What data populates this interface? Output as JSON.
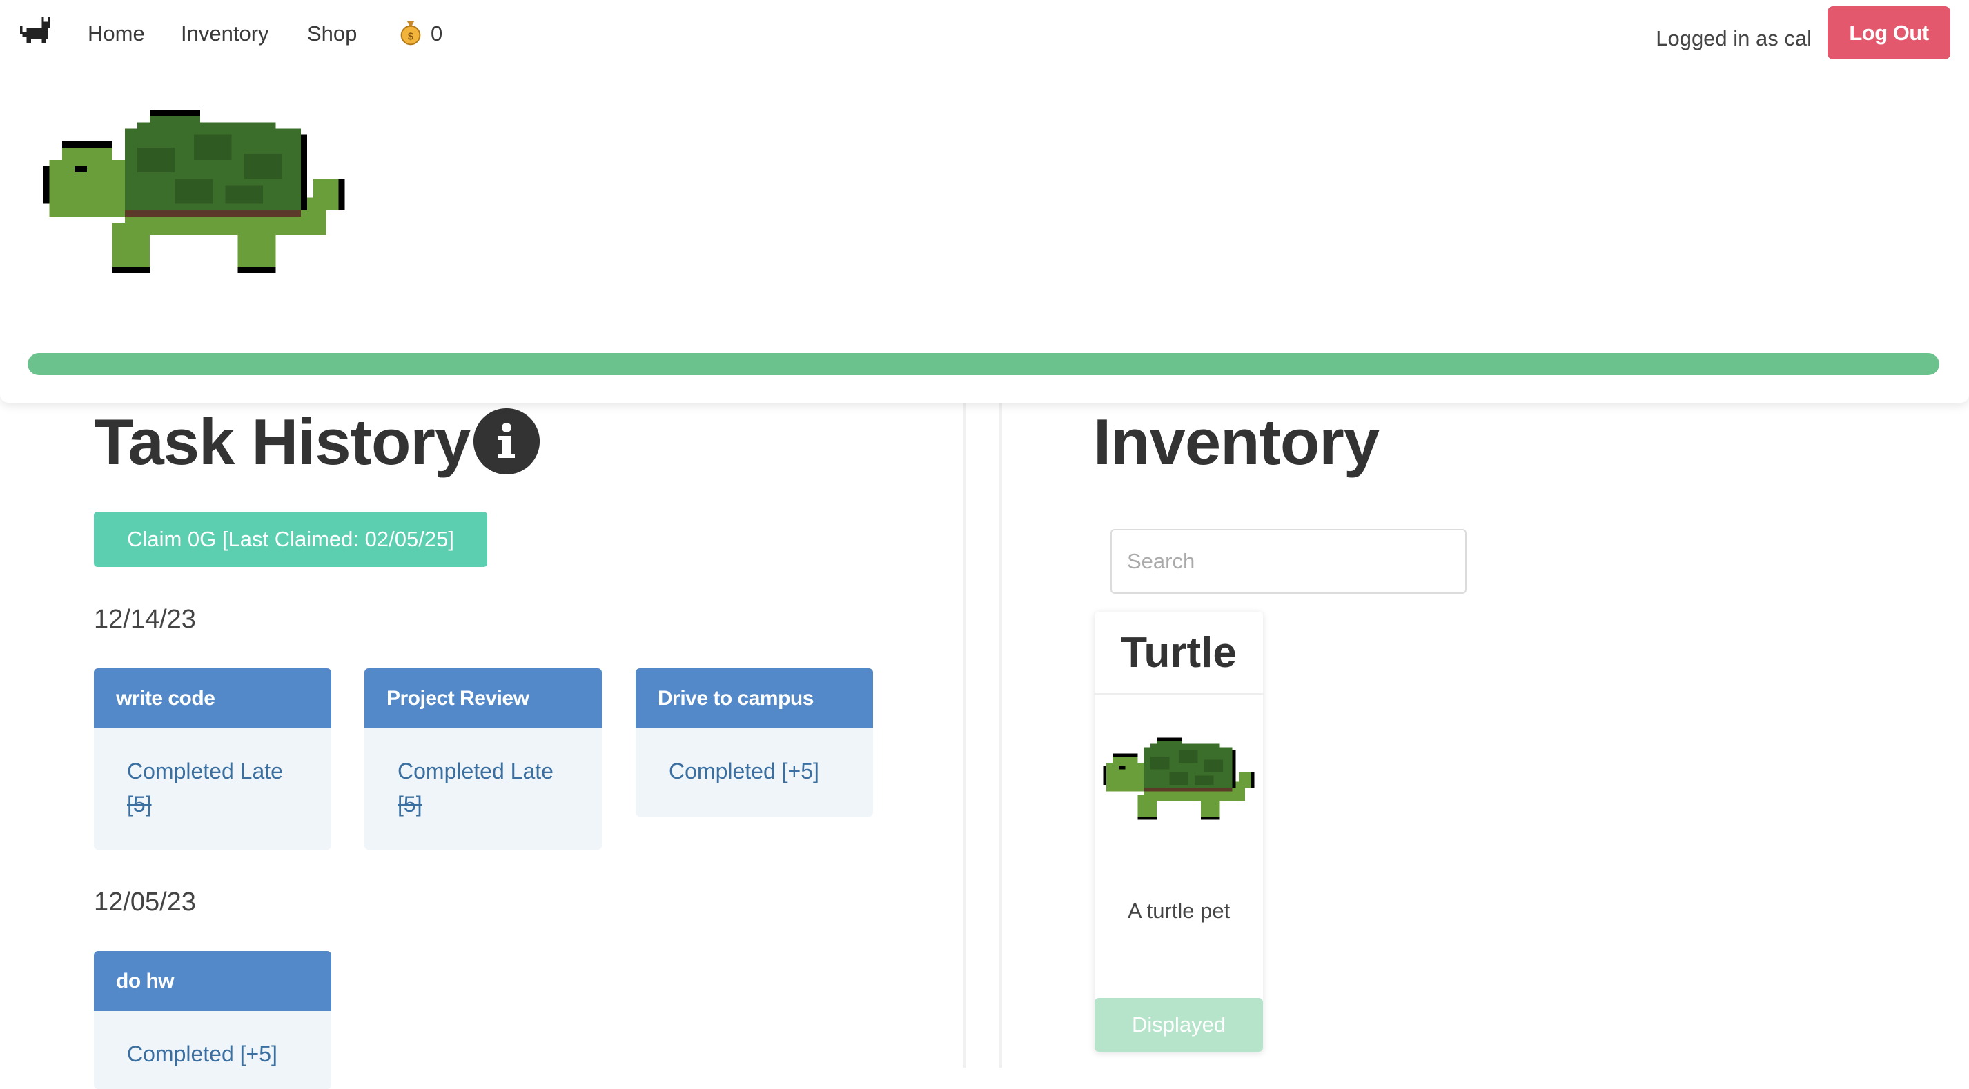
{
  "nav": {
    "home": "Home",
    "inventory": "Inventory",
    "shop": "Shop",
    "coins": "0",
    "logged_in": "Logged in as cal",
    "logout": "Log Out"
  },
  "pet": {
    "progress_fraction": 1.0,
    "progress_color": "#6cc28d"
  },
  "task_history": {
    "title": "Task History",
    "claim_button": "Claim 0G [Last Claimed: 02/05/25]",
    "groups": [
      {
        "date": "12/14/23",
        "tasks": [
          {
            "name": "write code",
            "status": "Completed Late",
            "reward": "[5]"
          },
          {
            "name": "Project Review",
            "status": "Completed Late",
            "reward": "[5]"
          },
          {
            "name": "Drive to campus",
            "status": "Completed [+5]"
          }
        ]
      },
      {
        "date": "12/05/23",
        "tasks": [
          {
            "name": "do hw",
            "status": "Completed [+5]"
          }
        ]
      }
    ]
  },
  "inventory": {
    "title": "Inventory",
    "search_placeholder": "Search",
    "items": [
      {
        "name": "Turtle",
        "description": "A turtle pet",
        "button": "Displayed"
      }
    ]
  },
  "colors": {
    "logout": "#e3586c",
    "claim": "#5ccfb0",
    "task_header": "#5389c8",
    "task_body": "#f0f5fa",
    "displayed": "#b5e4cb"
  }
}
